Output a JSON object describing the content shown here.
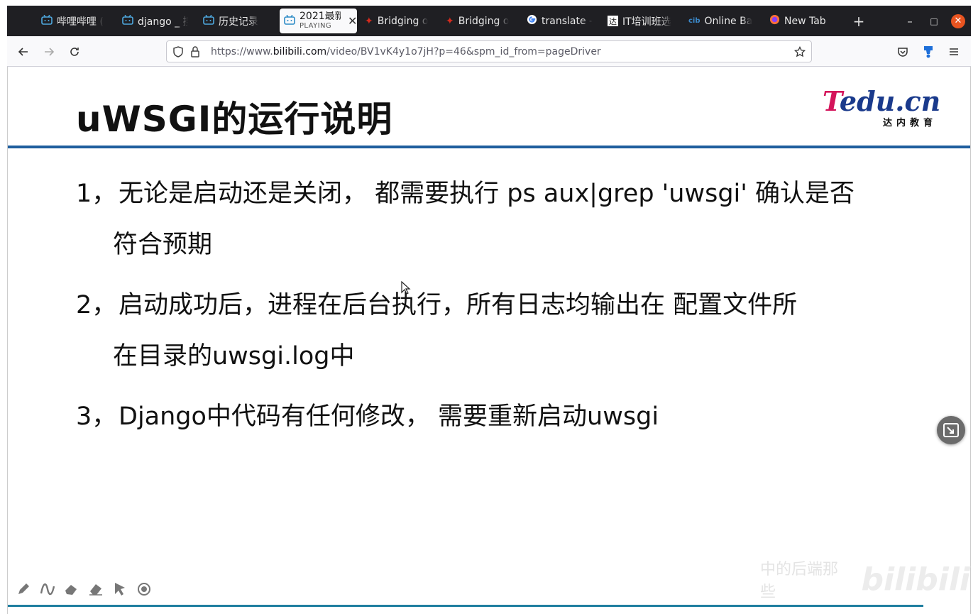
{
  "tabs": [
    {
      "label": "哔哩哔哩 (",
      "icon": "bilibili-icon"
    },
    {
      "label": "django _ 搜",
      "icon": "bilibili-icon"
    },
    {
      "label": "历史记录",
      "icon": "bilibili-icon"
    },
    {
      "label": "2021最新",
      "sub": "PLAYING",
      "icon": "bilibili-icon",
      "active": true
    },
    {
      "label": "Bridging o",
      "icon": "maple-leaf-icon"
    },
    {
      "label": "Bridging o",
      "icon": "maple-leaf-icon"
    },
    {
      "label": "translate -",
      "icon": "google-icon"
    },
    {
      "label": "IT培训班选",
      "icon": "tarena-icon"
    },
    {
      "label": "Online Ba",
      "icon": "cibc-icon"
    },
    {
      "label": "New Tab",
      "icon": "firefox-icon"
    }
  ],
  "window_controls": {
    "new_tab": "+",
    "minimize": "–",
    "maximize": "□",
    "close": "✕"
  },
  "address": {
    "prefix": "https://www.",
    "domain": "bilibili.com",
    "path": "/video/BV1vK4y1o7jH?p=46&spm_id_from=pageDriver"
  },
  "slide": {
    "title": "uWSGI的运行说明",
    "logo": {
      "main_t": "T",
      "main_rest": "edu.cn",
      "sub": "达内教育"
    },
    "items": [
      {
        "num": "1，",
        "line1": "无论是启动还是关闭，  都需要执行 ps aux|grep 'uwsgi' 确认是否",
        "line2": "符合预期"
      },
      {
        "num": "2，",
        "line1": "启动成功后，进程在后台执行，所有日志均输出在 配置文件所",
        "line2": "在目录的uwsgi.log中"
      },
      {
        "num": "3，",
        "line1": "Django中代码有任何修改，  需要重新启动uwsgi",
        "line2": ""
      }
    ]
  },
  "watermark": {
    "text": "中的后端那些",
    "brand": "bilibili"
  },
  "colors": {
    "accent": "#1f5e9e",
    "tab_bg": "#1f1f23",
    "close": "#e95420",
    "logo_red": "#d4145a",
    "logo_blue": "#1a3a8c"
  }
}
